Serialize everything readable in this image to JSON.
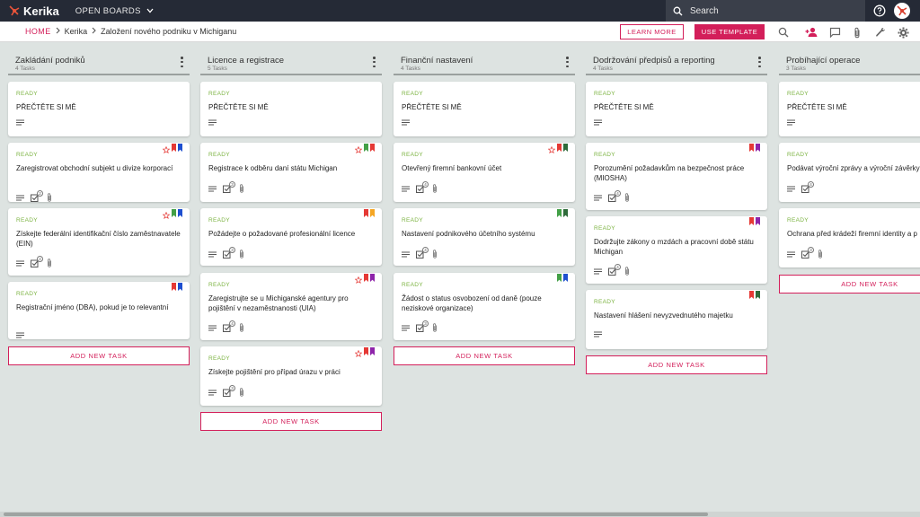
{
  "app": {
    "logo_text": "Kerika",
    "open_boards_label": "OPEN BOARDS",
    "search_placeholder": "Search"
  },
  "breadcrumb": {
    "home": "HOME",
    "items": [
      "Kerika",
      "Založení nového podniku v Michiganu"
    ]
  },
  "toolbar": {
    "learn_more": "LEARN MORE",
    "use_template": "USE TEMPLATE",
    "tools": [
      "search-icon",
      "add-person-icon",
      "chat-icon",
      "attachment-icon",
      "wrench-icon",
      "gear-icon"
    ]
  },
  "colors": {
    "accent": "#d31f5a",
    "ready": "#7cb342",
    "topbar": "#252a36",
    "board_bg": "#dde3e1",
    "flag_red": "#e53935",
    "flag_blue": "#1e4fd0",
    "flag_green": "#43a047",
    "flag_darkgreen": "#2e6b3a",
    "flag_purple": "#8e24aa",
    "flag_orange": "#f5a623"
  },
  "add_task_label": "ADD NEW TASK",
  "columns": [
    {
      "title": "Zakládání podniků",
      "count": "4 Tasks",
      "cards": [
        {
          "status": "READY",
          "title": "PŘEČTĚTE SI MĚ"
        },
        {
          "status": "READY",
          "title": "Zaregistrovat obchodní subjekt u divize korporací",
          "checklist": "2",
          "flags": [
            "star",
            "red",
            "blue"
          ]
        },
        {
          "status": "READY",
          "title": "Získejte federální identifikační číslo zaměstnavatele (EIN)",
          "checklist": "4",
          "flags": [
            "star",
            "green",
            "blue"
          ]
        },
        {
          "status": "READY",
          "title": "Registrační jméno (DBA), pokud je to relevantní",
          "flags": [
            "red",
            "blue"
          ]
        }
      ]
    },
    {
      "title": "Licence a registrace",
      "count": "5 Tasks",
      "cards": [
        {
          "status": "READY",
          "title": "PŘEČTĚTE SI MĚ"
        },
        {
          "status": "READY",
          "title": "Registrace k odběru daní státu Michigan",
          "checklist": "3",
          "flags": [
            "star",
            "green",
            "red"
          ]
        },
        {
          "status": "READY",
          "title": "Požádejte o požadované profesionální licence",
          "checklist": "3",
          "flags": [
            "red",
            "orange"
          ]
        },
        {
          "status": "READY",
          "title": "Zaregistrujte se u Michiganské agentury pro pojištění v nezaměstnanosti (UIA)",
          "checklist": "4",
          "flags": [
            "star",
            "red",
            "purple"
          ]
        },
        {
          "status": "READY",
          "title": "Získejte pojištění pro případ úrazu v práci",
          "checklist": "3",
          "flags": [
            "star",
            "red",
            "purple"
          ]
        }
      ]
    },
    {
      "title": "Finanční nastavení",
      "count": "4 Tasks",
      "cards": [
        {
          "status": "READY",
          "title": "PŘEČTĚTE SI MĚ"
        },
        {
          "status": "READY",
          "title": "Otevřený firemní bankovní účet",
          "checklist": "4",
          "flags": [
            "star",
            "red",
            "darkgreen"
          ]
        },
        {
          "status": "READY",
          "title": "Nastavení podnikového účetního systému",
          "checklist": "4",
          "flags": [
            "green",
            "darkgreen"
          ]
        },
        {
          "status": "READY",
          "title": "Žádost o status osvobození od daně (pouze neziskové organizace)",
          "checklist": "3",
          "flags": [
            "green",
            "blue"
          ]
        }
      ]
    },
    {
      "title": "Dodržování předpisů a reporting",
      "count": "4 Tasks",
      "cards": [
        {
          "status": "READY",
          "title": "PŘEČTĚTE SI MĚ"
        },
        {
          "status": "READY",
          "title": "Porozumění požadavkům na bezpečnost práce (MIOSHA)",
          "checklist": "4",
          "flags": [
            "red",
            "purple"
          ]
        },
        {
          "status": "READY",
          "title": "Dodržujte zákony o mzdách a pracovní době státu Michigan",
          "checklist": "4",
          "flags": [
            "red",
            "purple"
          ]
        },
        {
          "status": "READY",
          "title": "Nastavení hlášení nevyzvednutého majetku",
          "flags": [
            "red",
            "darkgreen"
          ]
        }
      ]
    },
    {
      "title": "Probíhající operace",
      "count": "3 Tasks",
      "cards": [
        {
          "status": "READY",
          "title": "PŘEČTĚTE SI MĚ"
        },
        {
          "status": "READY",
          "title": "Podávat výroční zprávy a výroční závěrky",
          "checklist": "4"
        },
        {
          "status": "READY",
          "title": "Ochrana před krádeží firemní identity a p",
          "checklist": "3"
        }
      ]
    }
  ]
}
